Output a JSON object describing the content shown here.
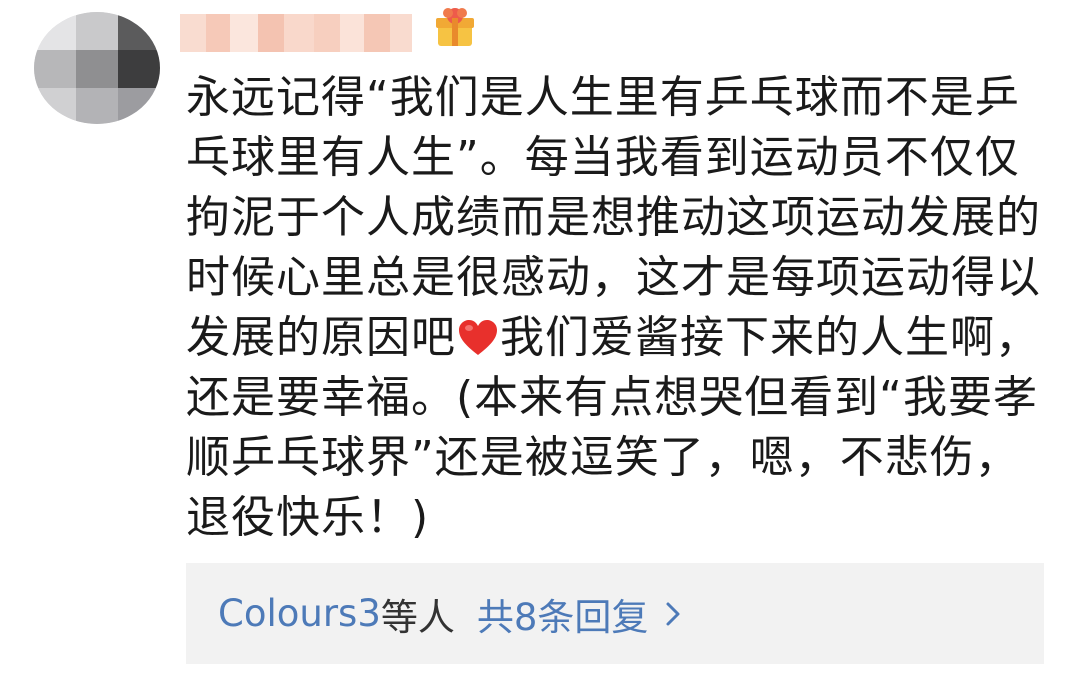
{
  "comment": {
    "lines": [
      "永远记得“我们是人生里有乒乓球而不是乒",
      "乓球里有人生”。每当我看到运动员不仅仅",
      "拘泥于个人成绩而是想推动这项运动发展的",
      "时候心里总是很感动，这才是每项运动得以",
      "发展的原因吧",
      "我们爱酱接下来的人生啊，",
      "还是要幸福。(本来有点想哭但看到“我要孝",
      "顺乒乓球界”还是被逗笑了，嗯，不悲伤，",
      "退役快乐！)"
    ],
    "inline_emoji": "red-heart-icon"
  },
  "replies": {
    "names": "Colours3",
    "suffix": "等人",
    "count_text": "共8条回复",
    "chevron": "chevron-right-icon"
  },
  "colors": {
    "link": "#4d7ab8",
    "reply_box_bg": "#f2f2f2",
    "heart": "#e8302c"
  }
}
